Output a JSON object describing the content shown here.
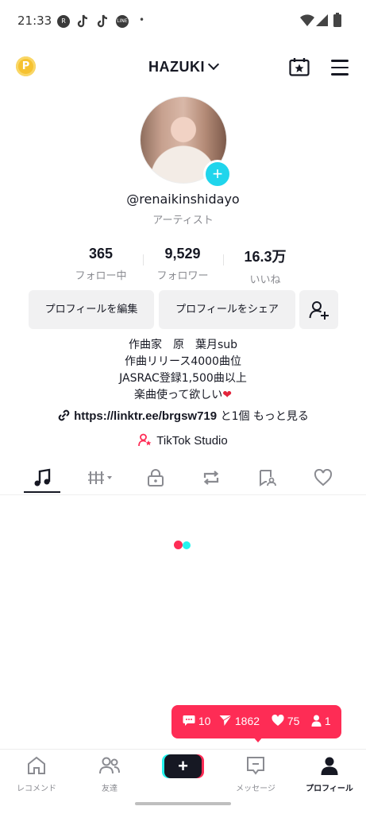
{
  "status_bar": {
    "time": "21:33",
    "notification_icons": [
      "rakuten-icon",
      "tiktok-icon",
      "tiktok-icon",
      "line-icon"
    ],
    "dot": "•",
    "system_icons": [
      "wifi-icon",
      "signal-icon",
      "battery-icon"
    ]
  },
  "header": {
    "coin_label": "P",
    "username": "HAZUKI"
  },
  "profile": {
    "handle": "@renaikinshidayo",
    "subtitle": "アーティスト"
  },
  "stats": [
    {
      "value": "365",
      "label": "フォロー中"
    },
    {
      "value": "9,529",
      "label": "フォロワー"
    },
    {
      "value": "16.3万",
      "label": "いいね"
    }
  ],
  "buttons": {
    "edit_profile": "プロフィールを編集",
    "share_profile": "プロフィールをシェア"
  },
  "bio": {
    "line1": "作曲家　原　葉月sub",
    "line2": "作曲リリース4000曲位",
    "line3": "JASRAC登録1,500曲以上",
    "line4": "楽曲使って欲しい",
    "heart": "❤"
  },
  "link": {
    "url": "https://linktr.ee/brgsw719",
    "more": " と1個 もっと見る"
  },
  "studio": {
    "label": "TikTok Studio"
  },
  "tabs": [
    {
      "icon": "music-note-icon",
      "active": true
    },
    {
      "icon": "playlist-icon",
      "active": false
    },
    {
      "icon": "lock-icon",
      "active": false
    },
    {
      "icon": "repost-icon",
      "active": false
    },
    {
      "icon": "tagged-icon",
      "active": false
    },
    {
      "icon": "heart-icon",
      "active": false
    }
  ],
  "notification": {
    "comments": "10",
    "followers_sent": "1862",
    "likes": "75",
    "new_followers": "1"
  },
  "bottom_nav": {
    "home": "レコメンド",
    "friends": "友達",
    "create": "+",
    "inbox": "メッセージ",
    "profile": "プロフィール"
  },
  "colors": {
    "accent": "#fe2c55",
    "cyan": "#25f4ee",
    "coin": "#f6c231",
    "text": "#161823",
    "muted": "#8a8b91"
  }
}
